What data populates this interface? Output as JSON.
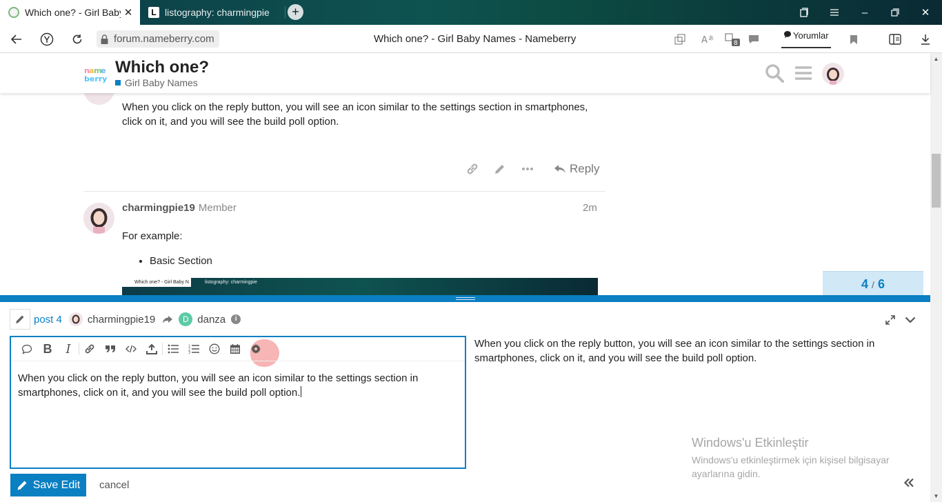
{
  "browser": {
    "tabs": [
      {
        "title": "Which one? - Girl Baby N",
        "active": true
      },
      {
        "title": "listography: charmingpie",
        "active": false
      }
    ],
    "new_tab": "+",
    "url": "forum.nameberry.com",
    "page_title": "Which one? - Girl Baby Names - Nameberry",
    "tab_badge": "8",
    "comments_label": "Yorumlar",
    "window_controls": {
      "minimize": "–",
      "close": "✕"
    }
  },
  "site": {
    "topic_title": "Which one?",
    "category": "Girl Baby Names",
    "category_color": "#0a7fc2"
  },
  "posts": {
    "previous_post_text": "When you click on the reply button, you will see an icon similar to the settings section in smartphones, click on it, and you will see the build poll option.",
    "reply_label": "Reply",
    "current_post": {
      "author": "charmingpie19",
      "role": "Member",
      "time": "2m",
      "intro": "For example:",
      "list": [
        "Basic Section"
      ],
      "embedded_tabs": [
        "Which one? - Girl Baby N",
        "listography: charmingpie"
      ]
    }
  },
  "timeline": {
    "current": "4",
    "separator": "/",
    "total": "6"
  },
  "composer": {
    "post_ref": "post 4",
    "reply_user": "charmingpie19",
    "to_user": "danza",
    "to_user_initial": "D",
    "info": "i",
    "editor_text": "When you click on the reply button, you will see an icon similar to the settings section in smartphones, click on it, and you will see the build poll option.",
    "preview_text": "When you click on the reply button, you will see an icon similar to the settings section in smartphones, click on it, and you will see the build poll option.",
    "save_label": "Save Edit",
    "cancel_label": "cancel",
    "toolbar_icons": [
      "speech-bubble-icon",
      "bold-icon",
      "italic-icon",
      "link-icon",
      "quote-icon",
      "code-icon",
      "upload-icon",
      "bullet-list-icon",
      "numbered-list-icon",
      "emoji-icon",
      "calendar-icon",
      "gear-icon"
    ],
    "accent": "#0a7fc2"
  },
  "watermark": {
    "title": "Windows'u Etkinleştir",
    "subtitle": "Windows'u etkinleştirmek için kişisel bilgisayar ayarlarına gidin."
  }
}
